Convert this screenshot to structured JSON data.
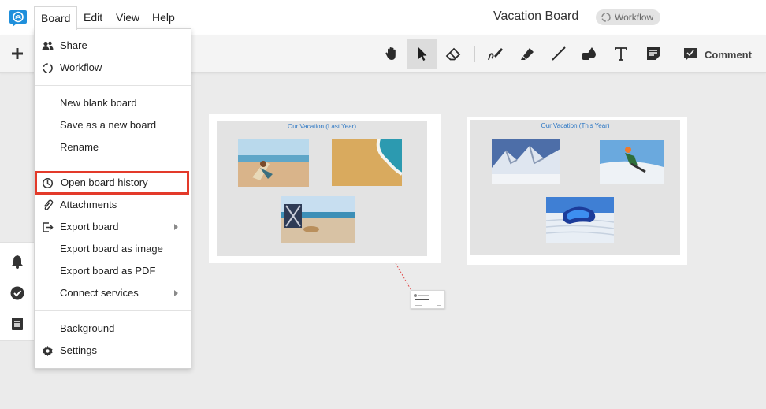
{
  "menubar": {
    "menus": [
      "Board",
      "Edit",
      "View",
      "Help"
    ],
    "board_title": "Vacation Board",
    "workflow_label": "Workflow"
  },
  "toolbar": {
    "tools": [
      "hand-icon",
      "select-arrow-icon",
      "eraser-icon",
      "pen-icon",
      "highlighter-icon",
      "line-icon",
      "shapes-icon",
      "text-icon",
      "note-icon"
    ],
    "selected_tool": "select-arrow-icon",
    "comment_label": "Comment"
  },
  "board_menu": {
    "items": [
      {
        "label": "Share",
        "icon": "share-users-icon"
      },
      {
        "label": "Workflow",
        "icon": "workflow-icon"
      },
      {
        "label": "New blank board"
      },
      {
        "label": "Save as a new board"
      },
      {
        "label": "Rename"
      },
      {
        "label": "Open board history",
        "icon": "clock-icon",
        "highlighted": true
      },
      {
        "label": "Attachments",
        "icon": "paperclip-icon"
      },
      {
        "label": "Export board",
        "icon": "export-icon",
        "submenu": true
      },
      {
        "label": "Export board as image"
      },
      {
        "label": "Export board as PDF"
      },
      {
        "label": "Connect services",
        "submenu": true
      },
      {
        "label": "Background"
      },
      {
        "label": "Settings",
        "icon": "gear-icon"
      }
    ]
  },
  "canvas": {
    "frames": [
      {
        "title": "Our Vacation (Last Year)",
        "photos": [
          "beach-chair-photo",
          "sand-wave-photo",
          "beach-bag-photo"
        ]
      },
      {
        "title": "Our Vacation (This Year)",
        "photos": [
          "snowy-mountains-photo",
          "snowboarder-photo",
          "ski-goggles-photo"
        ]
      }
    ]
  },
  "side_panel": {
    "icons": [
      "bell-icon",
      "check-circle-icon",
      "list-icon"
    ]
  },
  "colors": {
    "frame_title": "#2a76c4",
    "highlight_box": "#e33a2a",
    "logo": "#1f8fdb"
  }
}
